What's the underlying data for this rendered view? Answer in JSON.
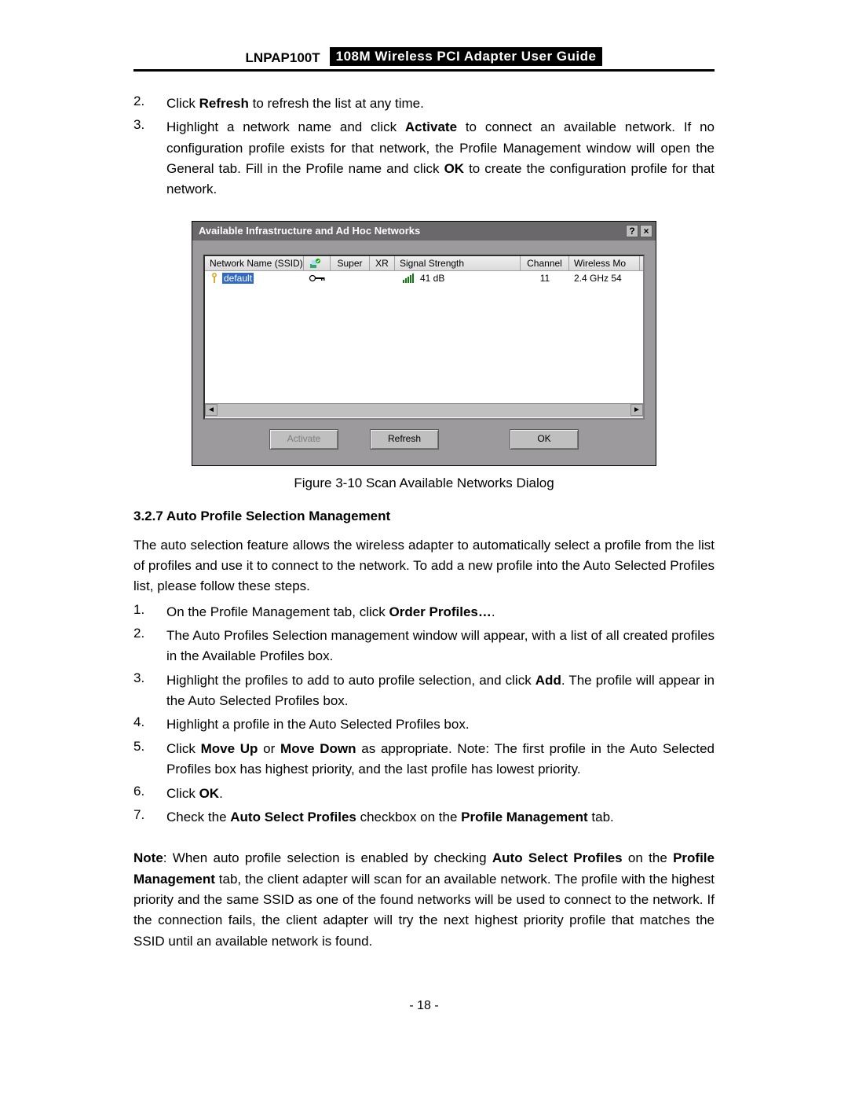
{
  "header": {
    "left": "LNPAP100T",
    "right": "108M  Wireless  PCI  Adapter  User  Guide"
  },
  "intro_list": [
    {
      "num": "2.",
      "parts": [
        {
          "t": "Click ",
          "b": false
        },
        {
          "t": "Refresh",
          "b": true
        },
        {
          "t": " to refresh the list at any time.",
          "b": false
        }
      ]
    },
    {
      "num": "3.",
      "parts": [
        {
          "t": "Highlight a network name and click ",
          "b": false
        },
        {
          "t": "Activate",
          "b": true
        },
        {
          "t": " to connect an available network. If no configuration profile exists for that network, the Profile Management window will open the General tab. Fill in the Profile name and click ",
          "b": false
        },
        {
          "t": "OK",
          "b": true
        },
        {
          "t": " to create the configuration profile for that network.",
          "b": false
        }
      ]
    }
  ],
  "dialog": {
    "title": "Available Infrastructure and Ad Hoc Networks",
    "help_glyph": "?",
    "close_glyph": "×",
    "columns": {
      "ssid": "Network Name (SSID)",
      "ico": "",
      "super": "Super",
      "xr": "XR",
      "signal": "Signal Strength",
      "channel": "Channel",
      "mode": "Wireless Mo"
    },
    "row": {
      "ssid": "default",
      "signal": "41 dB",
      "channel": "11",
      "mode": "2.4 GHz 54"
    },
    "buttons": {
      "activate": "Activate",
      "refresh": "Refresh",
      "ok": "OK"
    },
    "scroll_left": "◄",
    "scroll_right": "►"
  },
  "figure_caption": "Figure 3-10    Scan Available Networks Dialog",
  "section_title": "3.2.7 Auto Profile Selection Management",
  "section_intro": "The auto selection feature allows the wireless adapter to automatically select a profile from the list of profiles and use it to connect to the network. To add a new profile into the Auto Selected Profiles list, please follow these steps.",
  "steps": [
    {
      "num": "1.",
      "parts": [
        {
          "t": "On the Profile Management tab, click ",
          "b": false
        },
        {
          "t": "Order Profiles…",
          "b": true
        },
        {
          "t": ".",
          "b": false
        }
      ]
    },
    {
      "num": "2.",
      "parts": [
        {
          "t": "The Auto Profiles Selection management window will appear, with a list of all created profiles in the Available Profiles box.",
          "b": false
        }
      ]
    },
    {
      "num": "3.",
      "parts": [
        {
          "t": "Highlight the profiles to add to auto profile selection, and click ",
          "b": false
        },
        {
          "t": "Add",
          "b": true
        },
        {
          "t": ". The profile will appear in the Auto Selected Profiles box.",
          "b": false
        }
      ]
    },
    {
      "num": "4.",
      "parts": [
        {
          "t": "Highlight a profile in the Auto Selected Profiles box.",
          "b": false
        }
      ]
    },
    {
      "num": "5.",
      "parts": [
        {
          "t": "Click ",
          "b": false
        },
        {
          "t": "Move Up",
          "b": true
        },
        {
          "t": " or ",
          "b": false
        },
        {
          "t": "Move Down",
          "b": true
        },
        {
          "t": " as appropriate. Note: The first profile in the Auto Selected Profiles box has highest priority, and the last profile has lowest priority.",
          "b": false
        }
      ]
    },
    {
      "num": "6.",
      "parts": [
        {
          "t": "Click ",
          "b": false
        },
        {
          "t": "OK",
          "b": true
        },
        {
          "t": ".",
          "b": false
        }
      ]
    },
    {
      "num": "7.",
      "parts": [
        {
          "t": "Check the ",
          "b": false
        },
        {
          "t": "Auto Select Profiles",
          "b": true
        },
        {
          "t": " checkbox on the ",
          "b": false
        },
        {
          "t": "Profile Management",
          "b": true
        },
        {
          "t": " tab.",
          "b": false
        }
      ]
    }
  ],
  "note": [
    {
      "t": "Note",
      "b": true
    },
    {
      "t": ": When auto profile selection is enabled by checking ",
      "b": false
    },
    {
      "t": "Auto Select Profiles",
      "b": true
    },
    {
      "t": " on the ",
      "b": false
    },
    {
      "t": "Profile Management",
      "b": true
    },
    {
      "t": " tab, the client adapter will scan for an available network. The profile with the highest priority and the same SSID as one of the found networks will be used to connect to the network. If the connection fails, the client adapter will try the next highest priority profile that matches the SSID until an available network is found.",
      "b": false
    }
  ],
  "page_number": "- 18 -"
}
